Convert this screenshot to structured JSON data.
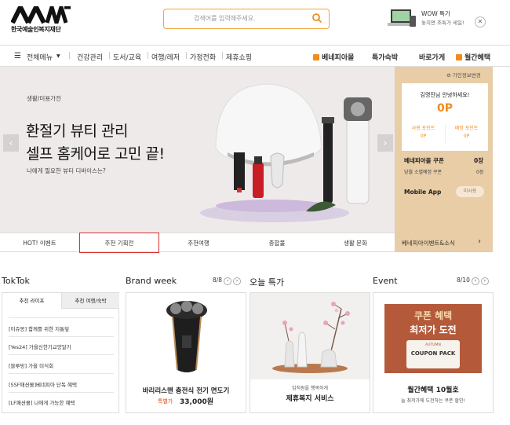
{
  "header": {
    "logo_text": "한국예술인복지재단",
    "search_placeholder": "검색어를 입력해주세요.",
    "promo_title": "WOW 특가",
    "promo_sub": "놓치면 조특가 세일!"
  },
  "gnb": {
    "menu_label": "전체메뉴",
    "categories": [
      "건강관리",
      "도서/교육",
      "여행/레저",
      "가정전화",
      "제휴쇼핑"
    ],
    "links": [
      "베네피아몰",
      "특가숙박",
      "바로가게",
      "월간혜택"
    ]
  },
  "hero": {
    "category": "생활/미용가전",
    "title_line1": "환절기 뷰티 관리",
    "title_line2": "셀프 홈케어로 고민 끝!",
    "subtitle": "나에게 필요한 뷰티 디바이스는?"
  },
  "side": {
    "info_link": "가인정보변경",
    "greeting": "김명진님 안녕하세요!",
    "points": "0P",
    "use_point_label": "사용 포인트",
    "use_point_value": "0P",
    "alloc_point_label": "배정 포인트",
    "alloc_point_value": "0P",
    "coupon_label": "베네피아몰 쿠폰",
    "coupon_value": "0장",
    "expire_label": "당월 소멸예정 쿠폰",
    "expire_value": "0장",
    "mobile_label": "Mobile App",
    "mobile_btn": "미사용"
  },
  "tabs": [
    "HOT! 이벤트",
    "추천 기획전",
    "추천여행",
    "종합몰",
    "생활 문화",
    "베네피아이벤트&소식"
  ],
  "toktok": {
    "title": "TokTok",
    "tab1": "추천 라이프",
    "tab2": "추천 여행/숙박",
    "items": [
      "[이쥬몽] 함께를 위한 지통잎",
      "[Yes24] 가을신한기교양알기",
      "[블루밍] 가을 미식회",
      "[SSF패션몰]베네피아 단독 혜택",
      "[LF패션몰] 나에게 가능한 혜택"
    ]
  },
  "brand_week": {
    "title": "Brand week",
    "pager": "8/8",
    "product": "바리리스맨 충전식 전기 면도기",
    "price_label": "특별가",
    "price": "33,000원"
  },
  "sale": {
    "title": "오늘 특가",
    "caption_small": "임직원을 행복하게",
    "caption": "제휴복지 서비스"
  },
  "event": {
    "title": "Event",
    "pager": "8/10",
    "banner_line1": "쿠폰 혜택",
    "banner_line2": "최저가 도전",
    "coupon_pack": "COUPON PACK",
    "autumn": "AUTUMN",
    "caption": "월간혜택 10월호",
    "caption_small": "늘 최저가에 도전하는 쿠폰 할인!"
  },
  "colors": {
    "accent": "#f08c1a",
    "red": "#e8481c",
    "beige": "#e8cda6",
    "hero_bg": "#efeaea"
  }
}
